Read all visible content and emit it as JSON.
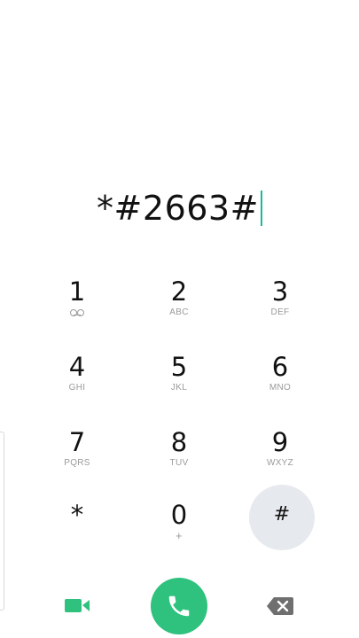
{
  "dialer": {
    "number": "*#2663#"
  },
  "keypad": {
    "keys": [
      {
        "digit": "1",
        "letters": ""
      },
      {
        "digit": "2",
        "letters": "ABC"
      },
      {
        "digit": "3",
        "letters": "DEF"
      },
      {
        "digit": "4",
        "letters": "GHI"
      },
      {
        "digit": "5",
        "letters": "JKL"
      },
      {
        "digit": "6",
        "letters": "MNO"
      },
      {
        "digit": "7",
        "letters": "PQRS"
      },
      {
        "digit": "8",
        "letters": "TUV"
      },
      {
        "digit": "9",
        "letters": "WXYZ"
      },
      {
        "digit": "*",
        "letters": ""
      },
      {
        "digit": "0",
        "letters": "+"
      },
      {
        "digit": "#",
        "letters": ""
      }
    ]
  },
  "actions": {
    "video_call_icon": "video-camera-icon",
    "call_icon": "phone-icon",
    "delete_icon": "backspace-icon"
  },
  "colors": {
    "accent": "#2ec27e",
    "cursor": "#1bb89a",
    "key_highlight": "#e6e9ee"
  }
}
